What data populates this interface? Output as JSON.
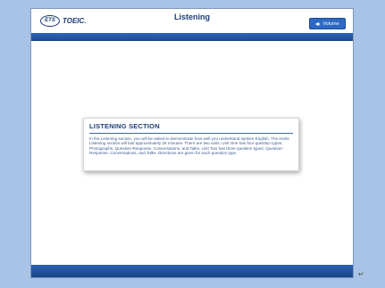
{
  "header": {
    "logo_ets": "ETS",
    "logo_text": "TOEIC.",
    "title": "Listening",
    "volume_label": "Volume"
  },
  "dialog": {
    "title": "LISTENING SECTION",
    "body": "In the Listening section, you will be asked to demonstrate how well you understand spoken English. The entire Listening section will last approximately 25 minutes. There are two units. Unit One has four question types: Photographs, Question-Response, Conversations, and Talks. Unit Two has three question types: Question-Response, Conversations, and Talks. Directions are given for each question type."
  },
  "footer": {
    "return_mark": "↵"
  },
  "colors": {
    "background": "#a9c3e6",
    "header_band": "#2f66b8",
    "button": "#2d69c4",
    "title_text": "#1f3e78"
  }
}
